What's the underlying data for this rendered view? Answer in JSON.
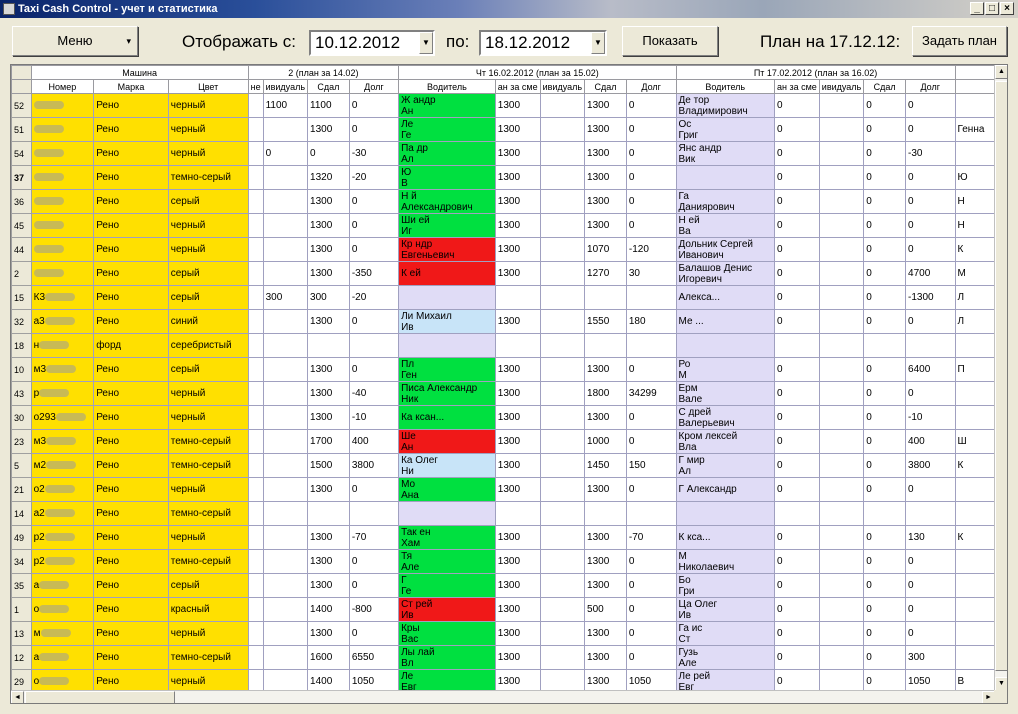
{
  "window": {
    "title": "Taxi Cash Control - учет и статистика",
    "min": "_",
    "max": "□",
    "close": "×"
  },
  "toolbar": {
    "menu_label": "Меню",
    "menu_arrow": "▾",
    "from_label": "Отображать с:",
    "from_value": "10.12.2012",
    "to_label": "по:",
    "to_value": "18.12.2012",
    "show_label": "Показать",
    "plan_label": "План на 17.12.12:",
    "set_plan_label": "Задать план"
  },
  "grid": {
    "group_headers": {
      "car": "Машина",
      "prev_day": "2 (план за 14.02)",
      "thu": "Чт 16.02.2012 (план за 15.02)",
      "fri": "Пт 17.02.2012 (план за 16.02)"
    },
    "col_headers": {
      "num": "Номер",
      "brand": "Марка",
      "color": "Цвет",
      "prev_ind": "ивидуаль",
      "prev_paid": "Сдал",
      "prev_debt": "Долг",
      "thu_driver": "Водитель",
      "thu_shift": "ан за сме",
      "thu_ind": "ивидуаль",
      "thu_paid": "Сдал",
      "thu_debt": "Долг",
      "fri_driver": "Водитель",
      "fri_shift": "ан за сме",
      "fri_ind": "ивидуаль",
      "fri_paid": "Сдал",
      "fri_debt": "Долг"
    },
    "rows": [
      {
        "id": "52",
        "num": "",
        "brand": "Рено",
        "color": "черный",
        "pi": "1100",
        "pp": "1100",
        "pd": "0",
        "td1": "Ж           андр",
        "td2": "Ан",
        "tc": "g",
        "ts": "1300",
        "ti": "",
        "tp": "1300",
        "tdb": "0",
        "fd1": "Де          тор",
        "fd2": "Владимирович",
        "fs": "0",
        "fi": "",
        "fp": "0",
        "fdb": "0"
      },
      {
        "id": "51",
        "num": "",
        "brand": "Рено",
        "color": "черный",
        "pi": "",
        "pp": "1300",
        "pd": "0",
        "td1": "Ле",
        "td2": "Ге",
        "tc": "g",
        "ts": "1300",
        "ti": "",
        "tp": "1300",
        "tdb": "0",
        "fd1": "Ос",
        "fd2": "Григ",
        "fs": "0",
        "fi": "",
        "fp": "0",
        "fdb": "0"
      },
      {
        "id": "54",
        "num": "",
        "brand": "Рено",
        "color": "черный",
        "pi": "0",
        "pp": "0",
        "pd": "-30",
        "td1": "Па            др",
        "td2": "Ал",
        "tc": "g",
        "ts": "1300",
        "ti": "",
        "tp": "1300",
        "tdb": "0",
        "fd1": "Янс          андр",
        "fd2": "Вик",
        "fs": "0",
        "fi": "",
        "fp": "0",
        "fdb": "-30"
      },
      {
        "id": "37",
        "bold": true,
        "num": "",
        "brand": "Рено",
        "color": "темно-серый",
        "pi": "",
        "pp": "1320",
        "pd": "-20",
        "td1": "Ю",
        "td2": "В",
        "tc": "g",
        "ts": "1300",
        "ti": "",
        "tp": "1300",
        "tdb": "0",
        "fd1": "",
        "fd2": "",
        "fs": "0",
        "fi": "",
        "fp": "0",
        "fdb": "0"
      },
      {
        "id": "36",
        "num": "",
        "brand": "Рено",
        "color": "серый",
        "pi": "",
        "pp": "1300",
        "pd": "0",
        "td1": "Н           й",
        "td2": "Александрович",
        "tc": "g",
        "ts": "1300",
        "ti": "",
        "tp": "1300",
        "tdb": "0",
        "fd1": "Га",
        "fd2": "Даниярович",
        "fs": "0",
        "fi": "",
        "fp": "0",
        "fdb": "0"
      },
      {
        "id": "45",
        "num": "",
        "brand": "Рено",
        "color": "черный",
        "pi": "",
        "pp": "1300",
        "pd": "0",
        "td1": "Ши          ей",
        "td2": "Иг",
        "tc": "g",
        "ts": "1300",
        "ti": "",
        "tp": "1300",
        "tdb": "0",
        "fd1": "Н           ей",
        "fd2": "Ва",
        "fs": "0",
        "fi": "",
        "fp": "0",
        "fdb": "0"
      },
      {
        "id": "44",
        "num": "",
        "brand": "Рено",
        "color": "черный",
        "pi": "",
        "pp": "1300",
        "pd": "0",
        "td1": "Кр          ндр",
        "td2": "Евгеньевич",
        "tc": "r",
        "ts": "1300",
        "ti": "",
        "tp": "1070",
        "tdb": "-120",
        "fd1": "Дольник Сергей",
        "fd2": "Иванович",
        "fs": "0",
        "fi": "",
        "fp": "0",
        "fdb": "0"
      },
      {
        "id": "2",
        "num": "",
        "brand": "Рено",
        "color": "серый",
        "pi": "",
        "pp": "1300",
        "pd": "-350",
        "td1": "К           ей",
        "td2": "",
        "tc": "r",
        "ts": "1300",
        "ti": "",
        "tp": "1270",
        "tdb": "30",
        "fd1": "Балашов Денис",
        "fd2": "Игоревич",
        "fs": "0",
        "fi": "",
        "fp": "0",
        "fdb": "4700"
      },
      {
        "id": "15",
        "num": "К3",
        "brand": "Рено",
        "color": "серый",
        "pi": "300",
        "pp": "300",
        "pd": "-20",
        "td1": "",
        "td2": "",
        "tc": "l",
        "ts": "",
        "ti": "",
        "tp": "",
        "tdb": "",
        "fd1": "         Алекса...",
        "fd2": "",
        "fs": "0",
        "fi": "",
        "fp": "0",
        "fdb": "-1300"
      },
      {
        "id": "32",
        "num": "а3",
        "brand": "Рено",
        "color": "синий",
        "pi": "",
        "pp": "1300",
        "pd": "0",
        "td1": "Ли          Михаил",
        "td2": "Ив",
        "tc": "b",
        "ts": "1300",
        "ti": "",
        "tp": "1550",
        "tdb": "180",
        "fd1": "Ме             ...",
        "fd2": "",
        "fs": "0",
        "fi": "",
        "fp": "0",
        "fdb": "0"
      },
      {
        "id": "18",
        "num": "н",
        "brand": "форд",
        "color": "серебристый",
        "pi": "",
        "pp": "",
        "pd": "",
        "td1": "",
        "td2": "",
        "tc": "l",
        "ts": "",
        "ti": "",
        "tp": "",
        "tdb": "",
        "fd1": "",
        "fd2": "",
        "fs": "",
        "fi": "",
        "fp": "",
        "fdb": ""
      },
      {
        "id": "10",
        "num": "м3",
        "brand": "Рено",
        "color": "серый",
        "pi": "",
        "pp": "1300",
        "pd": "0",
        "td1": "Пл",
        "td2": "Ген",
        "tc": "g",
        "ts": "1300",
        "ti": "",
        "tp": "1300",
        "tdb": "0",
        "fd1": "Ро",
        "fd2": "М",
        "fs": "0",
        "fi": "",
        "fp": "0",
        "fdb": "6400"
      },
      {
        "id": "43",
        "num": "р",
        "brand": "Рено",
        "color": "черный",
        "pi": "",
        "pp": "1300",
        "pd": "-40",
        "td1": "Писа      Александр",
        "td2": "Ник",
        "tc": "g",
        "ts": "1300",
        "ti": "",
        "tp": "1800",
        "tdb": "34299",
        "fd1": "Ерм",
        "fd2": "Вале",
        "fs": "0",
        "fi": "",
        "fp": "0",
        "fdb": "0"
      },
      {
        "id": "30",
        "num": "о293",
        "brand": "Рено",
        "color": "черный",
        "pi": "",
        "pp": "1300",
        "pd": "-10",
        "td1": "Ка          ксан...",
        "td2": "",
        "tc": "g",
        "ts": "1300",
        "ti": "",
        "tp": "1300",
        "tdb": "0",
        "fd1": "С          дрей",
        "fd2": "Валерьевич",
        "fs": "0",
        "fi": "",
        "fp": "0",
        "fdb": "-10"
      },
      {
        "id": "23",
        "num": "м3",
        "brand": "Рено",
        "color": "темно-серый",
        "pi": "",
        "pp": "1700",
        "pd": "400",
        "td1": "Ше",
        "td2": "Ан",
        "tc": "r",
        "ts": "1300",
        "ti": "",
        "tp": "1000",
        "tdb": "0",
        "fd1": "Кром     лексей",
        "fd2": "Вла",
        "fs": "0",
        "fi": "",
        "fp": "0",
        "fdb": "400"
      },
      {
        "id": "5",
        "num": "м2",
        "brand": "Рено",
        "color": "темно-серый",
        "pi": "",
        "pp": "1500",
        "pd": "3800",
        "td1": "Ка        Олег",
        "td2": "Ни",
        "tc": "b",
        "ts": "1300",
        "ti": "",
        "tp": "1450",
        "tdb": "150",
        "fd1": "Г           мир",
        "fd2": "Ал",
        "fs": "0",
        "fi": "",
        "fp": "0",
        "fdb": "3800"
      },
      {
        "id": "21",
        "num": "о2",
        "brand": "Рено",
        "color": "черный",
        "pi": "",
        "pp": "1300",
        "pd": "0",
        "td1": "Мо",
        "td2": "Ана",
        "tc": "g",
        "ts": "1300",
        "ti": "",
        "tp": "1300",
        "tdb": "0",
        "fd1": "Г         Александр",
        "fd2": "",
        "fs": "0",
        "fi": "",
        "fp": "0",
        "fdb": "0"
      },
      {
        "id": "14",
        "num": "а2",
        "brand": "Рено",
        "color": "темно-серый",
        "pi": "",
        "pp": "",
        "pd": "",
        "td1": "",
        "td2": "",
        "tc": "l",
        "ts": "",
        "ti": "",
        "tp": "",
        "tdb": "",
        "fd1": "",
        "fd2": "",
        "fs": "",
        "fi": "",
        "fp": "",
        "fdb": ""
      },
      {
        "id": "49",
        "num": "р2",
        "brand": "Рено",
        "color": "черный",
        "pi": "",
        "pp": "1300",
        "pd": "-70",
        "td1": "Так         ен",
        "td2": "Хам",
        "tc": "g",
        "ts": "1300",
        "ti": "",
        "tp": "1300",
        "tdb": "-70",
        "fd1": "К           кса...",
        "fd2": "",
        "fs": "0",
        "fi": "",
        "fp": "0",
        "fdb": "130"
      },
      {
        "id": "34",
        "num": "р2",
        "brand": "Рено",
        "color": "темно-серый",
        "pi": "",
        "pp": "1300",
        "pd": "0",
        "td1": "Тя",
        "td2": "Але",
        "tc": "g",
        "ts": "1300",
        "ti": "",
        "tp": "1300",
        "tdb": "0",
        "fd1": "М",
        "fd2": "Николаевич",
        "fs": "0",
        "fi": "",
        "fp": "0",
        "fdb": "0"
      },
      {
        "id": "35",
        "num": "а",
        "brand": "Рено",
        "color": "серый",
        "pi": "",
        "pp": "1300",
        "pd": "0",
        "td1": "Г",
        "td2": "Ге",
        "tc": "g",
        "ts": "1300",
        "ti": "",
        "tp": "1300",
        "tdb": "0",
        "fd1": "Бо",
        "fd2": "Гри",
        "fs": "0",
        "fi": "",
        "fp": "0",
        "fdb": "0"
      },
      {
        "id": "1",
        "num": "о",
        "brand": "Рено",
        "color": "красный",
        "pi": "",
        "pp": "1400",
        "pd": "-800",
        "td1": "Ст          рей",
        "td2": "Ив",
        "tc": "r",
        "ts": "1300",
        "ti": "",
        "tp": "500",
        "tdb": "0",
        "fd1": "Ца         Олег",
        "fd2": "Ив",
        "fs": "0",
        "fi": "",
        "fp": "0",
        "fdb": "0"
      },
      {
        "id": "13",
        "num": "м",
        "brand": "Рено",
        "color": "черный",
        "pi": "",
        "pp": "1300",
        "pd": "0",
        "td1": "Кры",
        "td2": "Вас",
        "tc": "g",
        "ts": "1300",
        "ti": "",
        "tp": "1300",
        "tdb": "0",
        "fd1": "Га          ис",
        "fd2": "Ст",
        "fs": "0",
        "fi": "",
        "fp": "0",
        "fdb": "0"
      },
      {
        "id": "12",
        "num": "а",
        "brand": "Рено",
        "color": "темно-серый",
        "pi": "",
        "pp": "1600",
        "pd": "6550",
        "td1": "Лы           лай",
        "td2": "Вл",
        "tc": "g",
        "ts": "1300",
        "ti": "",
        "tp": "1300",
        "tdb": "0",
        "fd1": "Гузь",
        "fd2": "Але",
        "fs": "0",
        "fi": "",
        "fp": "0",
        "fdb": "300"
      },
      {
        "id": "29",
        "num": "о",
        "brand": "Рено",
        "color": "черный",
        "pi": "",
        "pp": "1400",
        "pd": "1050",
        "td1": "Ле",
        "td2": "Евг",
        "tc": "g",
        "ts": "1300",
        "ti": "",
        "tp": "1300",
        "tdb": "1050",
        "fd1": "Ле         рей",
        "fd2": "Евг",
        "fs": "0",
        "fi": "",
        "fp": "0",
        "fdb": "1050"
      }
    ]
  },
  "extra_col_texts": [
    "",
    "Генна",
    "",
    "Ю",
    "Н",
    "Н",
    "К",
    "М",
    "Л",
    "Л",
    "",
    "П",
    "",
    "",
    "Ш",
    "К",
    "",
    "",
    "К",
    "",
    "",
    "",
    "",
    "",
    "В"
  ],
  "scroll": {
    "up": "▲",
    "down": "▼",
    "left": "◄",
    "right": "►"
  }
}
